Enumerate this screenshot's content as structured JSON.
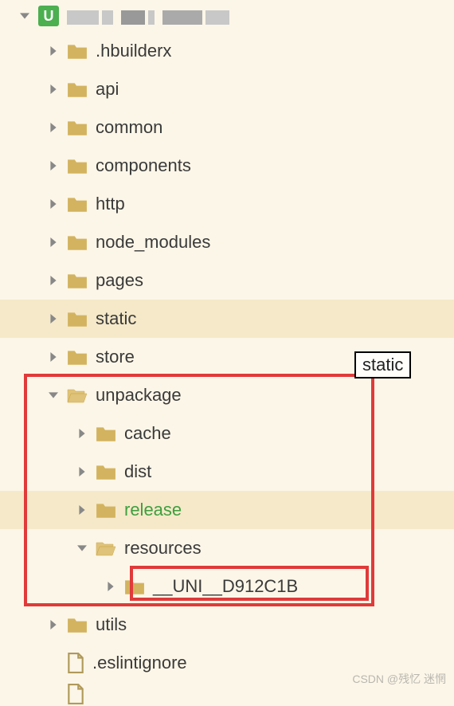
{
  "root": {
    "app_glyph": "U"
  },
  "tree": {
    "hbuilderx": ".hbuilderx",
    "api": "api",
    "common": "common",
    "components": "components",
    "http": "http",
    "node_modules": "node_modules",
    "pages": "pages",
    "static": "static",
    "store": "store",
    "unpackage": "unpackage",
    "cache": "cache",
    "dist": "dist",
    "release": "release",
    "resources": "resources",
    "uni_dir": "__UNI__D912C1B",
    "utils": "utils",
    "eslintignore": ".eslintignore"
  },
  "tooltip": "static",
  "watermark": "CSDN @残忆 迷惘",
  "colors": {
    "folder": "#d3b35f",
    "folder_open": "#e0c37a",
    "highlight_red": "#e03a3a",
    "green_text": "#3f9e3f",
    "bg": "#fcf6e8",
    "row_highlight": "#f5e9c9"
  }
}
